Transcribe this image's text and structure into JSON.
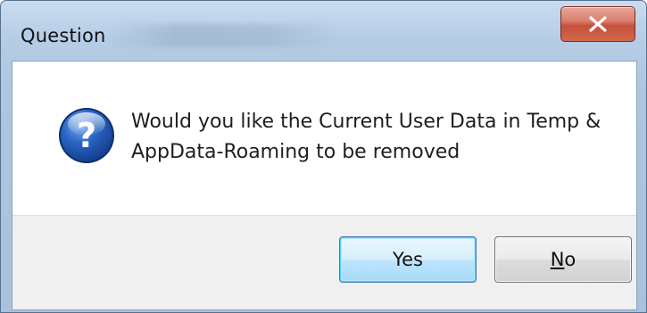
{
  "window": {
    "title": "Question",
    "close_symbol": "X"
  },
  "dialog": {
    "icon": "question-icon",
    "message_line1": "Would you like the Current User Data in Temp &",
    "message_line2": "AppData-Roaming to be removed"
  },
  "buttons": {
    "yes_label": "Yes",
    "no_mnemonic": "N",
    "no_rest": "o"
  },
  "colors": {
    "titlebar": "#b6cde6",
    "close_button": "#c6503b",
    "button_area": "#f0f0f0",
    "default_button_border": "#3c7fb1",
    "icon_blue": "#1d4fa3"
  }
}
